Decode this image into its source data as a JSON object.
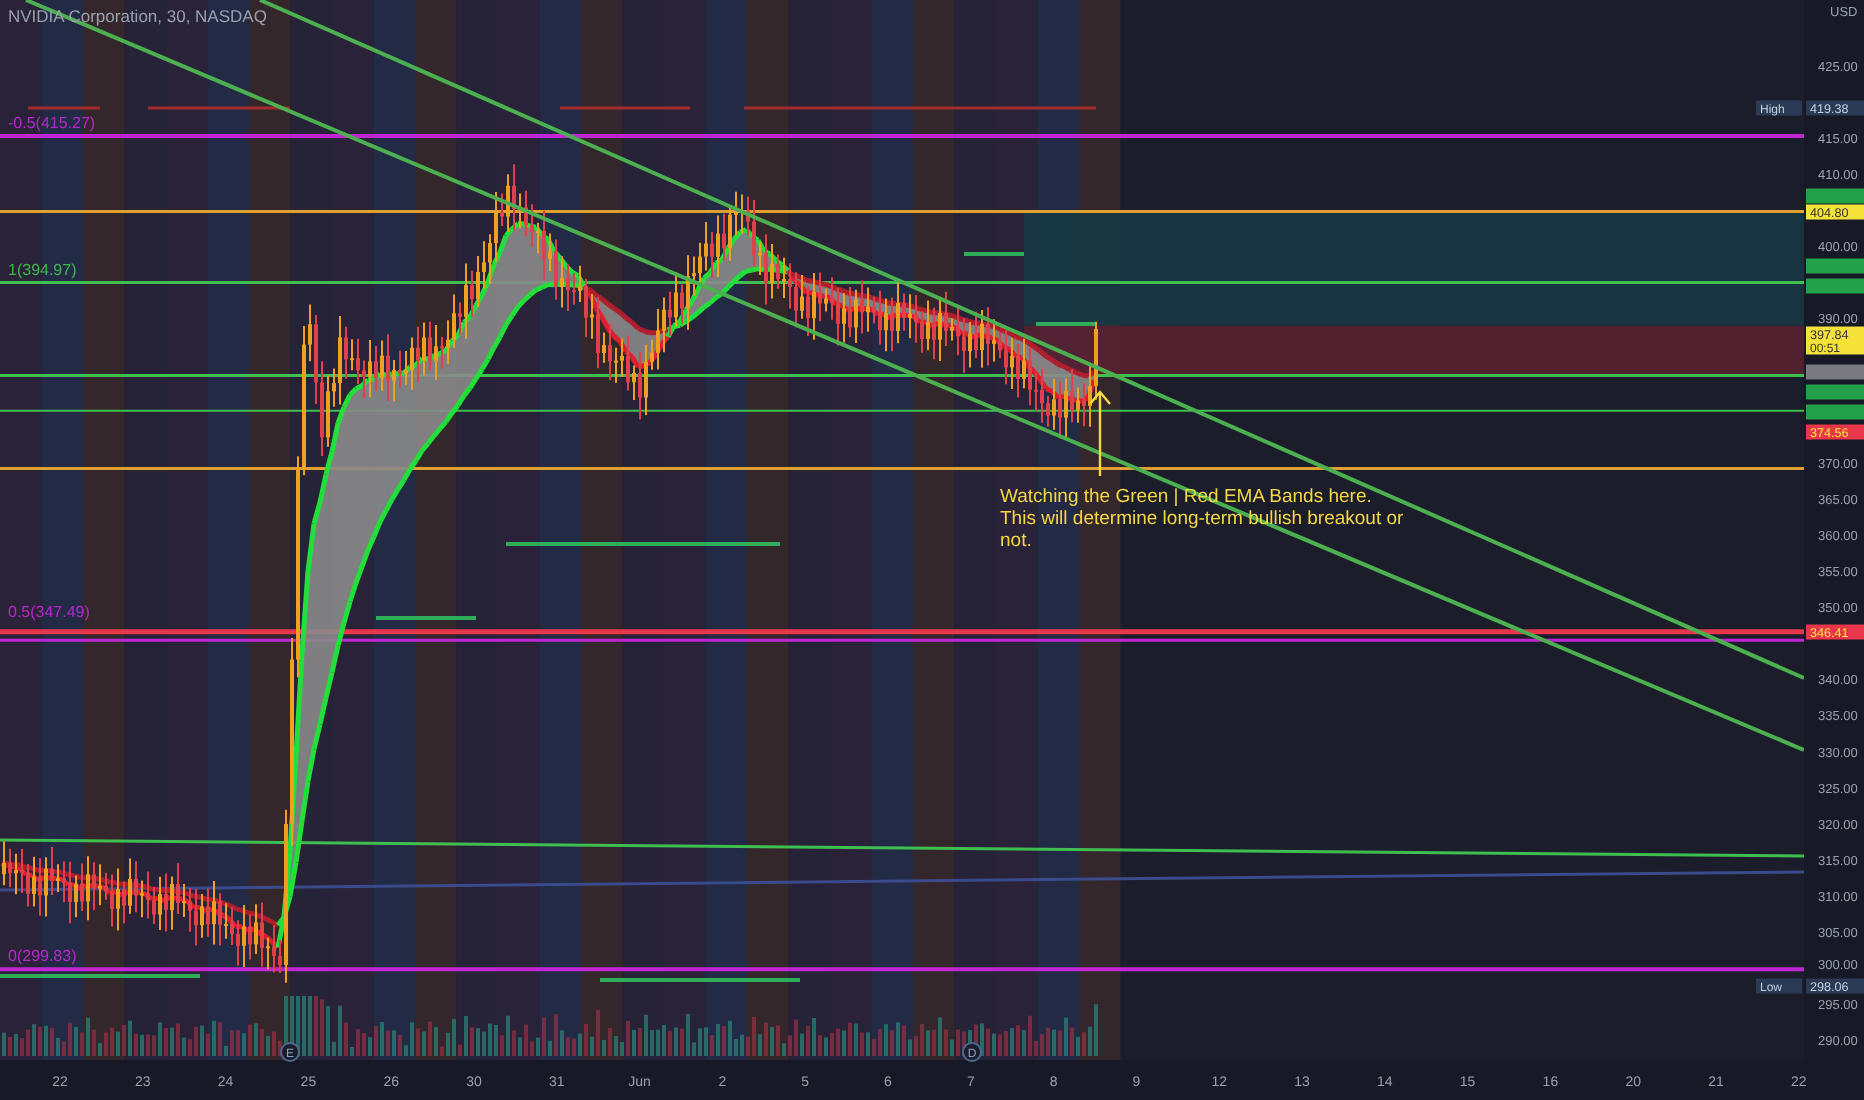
{
  "symbol_title": "NVIDIA Corporation, 30, NASDAQ",
  "currency": "USD",
  "price_axis": [
    "425.00",
    "415.00",
    "410.00",
    "400.00",
    "390.00",
    "370.00",
    "365.00",
    "360.00",
    "355.00",
    "350.00",
    "340.00",
    "335.00",
    "330.00",
    "325.00",
    "320.00",
    "315.00",
    "310.00",
    "305.00",
    "300.00",
    "295.00",
    "290.00"
  ],
  "price_badges": [
    {
      "label": "High",
      "text": "419.38",
      "color": "#2a3a55"
    },
    {
      "color": "#22a04a"
    },
    {
      "text": "404.80",
      "color": "#f2e23a"
    },
    {
      "color": "#22a04a"
    },
    {
      "color": "#22a04a"
    },
    {
      "text": "397.84",
      "sub": "00:51",
      "color": "#f2e23a"
    },
    {
      "color": "#7a7a80"
    },
    {
      "color": "#22a04a"
    },
    {
      "color": "#22a04a"
    },
    {
      "text": "374.56",
      "color": "#e8364a"
    },
    {
      "text": "346.41",
      "color": "#e8364a"
    },
    {
      "label": "Low",
      "text": "298.06",
      "color": "#2a3a55"
    }
  ],
  "fib_levels": [
    {
      "label": "-0.5(415.27)",
      "color": "#c026d3"
    },
    {
      "label": "1(394.97)",
      "color": "#3fbf4f"
    },
    {
      "label": "0.5(347.49)",
      "color": "#c026d3"
    },
    {
      "label": "0(299.83)",
      "color": "#c026d3"
    }
  ],
  "time_axis": [
    "22",
    "23",
    "24",
    "25",
    "26",
    "30",
    "31",
    "Jun",
    "2",
    "5",
    "6",
    "7",
    "8",
    "9",
    "12",
    "13",
    "14",
    "15",
    "16",
    "20",
    "21",
    "22"
  ],
  "event_markers": [
    {
      "text": "E"
    },
    {
      "text": "D"
    }
  ],
  "annotation": {
    "lines": [
      "Watching the Green | Red EMA Bands here.",
      "This will determine long-term bullish breakout or",
      "not."
    ]
  }
}
